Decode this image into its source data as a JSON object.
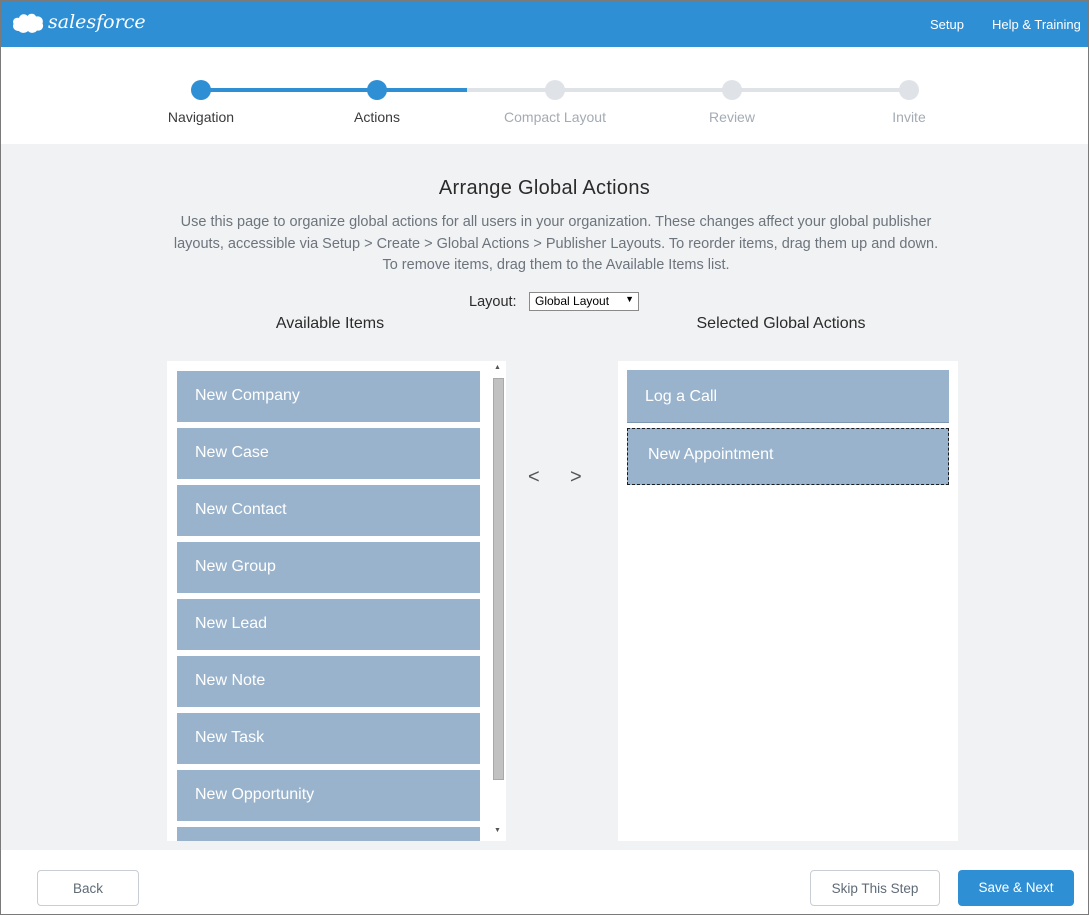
{
  "header": {
    "logo_text": "salesforce",
    "links": [
      "Setup",
      "Help & Training"
    ]
  },
  "steps": [
    {
      "label": "Navigation",
      "done": true
    },
    {
      "label": "Actions",
      "done": true
    },
    {
      "label": "Compact Layout",
      "done": false
    },
    {
      "label": "Review",
      "done": false
    },
    {
      "label": "Invite",
      "done": false
    }
  ],
  "main": {
    "title": "Arrange Global Actions",
    "description": "Use this page to organize global actions for all users in your organization. These changes affect your global publisher layouts, accessible via Setup > Create > Global Actions > Publisher Layouts. To reorder items, drag them up and down. To remove items, drag them to the Available Items list.",
    "layout_label": "Layout:",
    "layout_value": "Global Layout",
    "available_title": "Available Items",
    "selected_title": "Selected Global Actions",
    "available_items": [
      "New Company",
      "New Case",
      "New Contact",
      "New Group",
      "New Lead",
      "New Note",
      "New Task",
      "New Opportunity",
      ""
    ],
    "selected_items": [
      "Log a Call",
      "New Appointment"
    ],
    "move_left": "<",
    "move_right": ">"
  },
  "footer": {
    "back_label": "Back",
    "skip_label": "Skip This Step",
    "save_label": "Save & Next"
  },
  "colors": {
    "brand": "#2f8fd5",
    "item_bg": "#99b3cc",
    "page_bg": "#f0f2f4"
  }
}
